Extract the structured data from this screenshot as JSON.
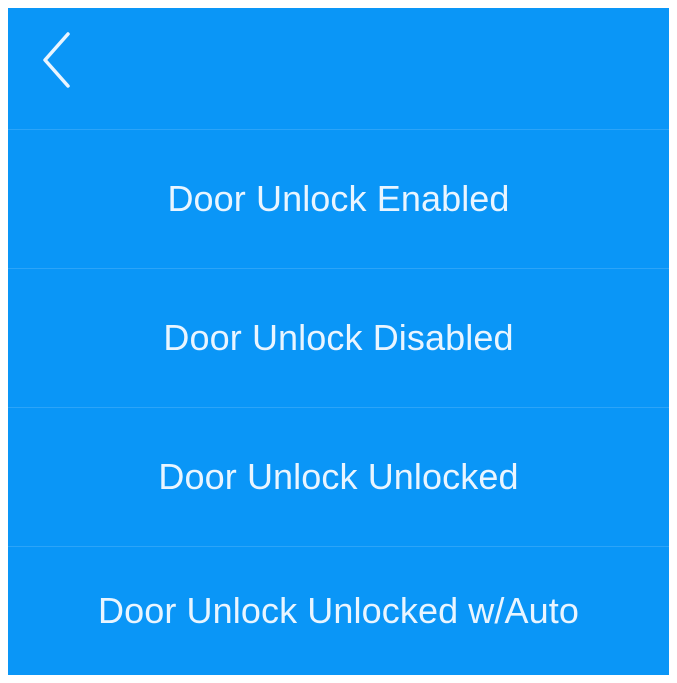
{
  "header": {
    "back_icon": "chevron-left-icon"
  },
  "menu": {
    "items": [
      {
        "label": "Door Unlock Enabled"
      },
      {
        "label": "Door Unlock Disabled"
      },
      {
        "label": "Door Unlock Unlocked"
      },
      {
        "label": "Door Unlock Unlocked w/Auto"
      }
    ]
  },
  "colors": {
    "background": "#0a96f7",
    "text": "#e9f5ff",
    "divider": "#35a8f8",
    "outer_frame": "#ffffff"
  }
}
